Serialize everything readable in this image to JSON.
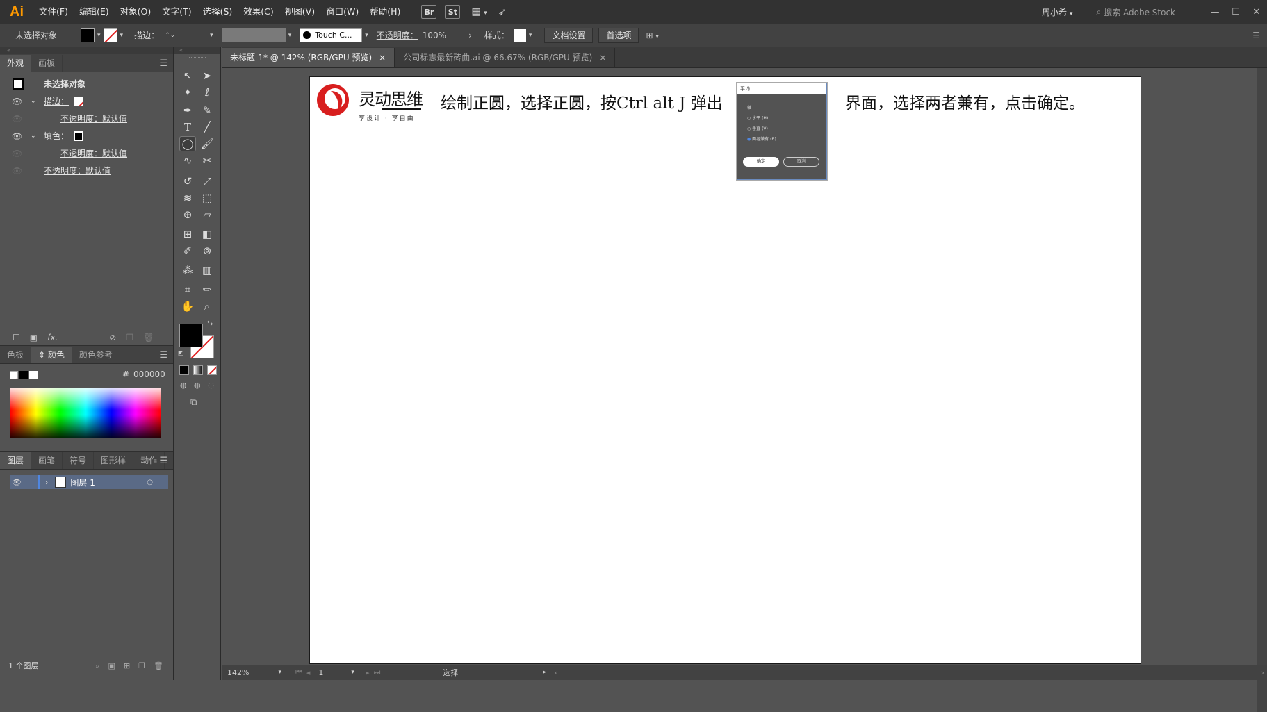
{
  "menubar": {
    "logo": "Ai",
    "menus": [
      "文件(F)",
      "编辑(E)",
      "对象(O)",
      "文字(T)",
      "选择(S)",
      "效果(C)",
      "视图(V)",
      "窗口(W)",
      "帮助(H)"
    ],
    "bridge": "Br",
    "stock": "St",
    "user": "周小希",
    "search_placeholder": "搜索 Adobe Stock",
    "win_minimize": "—",
    "win_maximize": "☐",
    "win_close": "✕"
  },
  "control_bar": {
    "selection": "未选择对象",
    "stroke_label": "描边：",
    "brush": "Touch C...",
    "opacity_label": "不透明度：",
    "opacity_value": "100%",
    "style_label": "样式：",
    "doc_setup": "文档设置",
    "preferences": "首选项"
  },
  "appearance_panel": {
    "tabs": [
      "外观",
      "画板"
    ],
    "title": "未选择对象",
    "stroke_label": "描边：",
    "stroke_opacity": "不透明度：默认值",
    "fill_label": "填色：",
    "fill_opacity": "不透明度：默认值",
    "opacity": "不透明度：默认值",
    "fx": "fx."
  },
  "color_panel": {
    "tabs": [
      "色板",
      "颜色",
      "颜色参考"
    ],
    "hash": "#",
    "hex": "000000"
  },
  "layers_panel": {
    "tabs": [
      "图层",
      "画笔",
      "符号",
      "图形样",
      "动作"
    ],
    "layer_name": "图层 1",
    "count": "1 个图层"
  },
  "document_tabs": [
    {
      "label": "未标题-1* @ 142% (RGB/GPU 预览)",
      "close": "×"
    },
    {
      "label": "公司标志最新砖曲.ai @ 66.67% (RGB/GPU 预览)",
      "close": "×"
    }
  ],
  "artboard": {
    "logo_text": "灵动思维",
    "logo_sub": "享设计 · 享自由",
    "instruction_1": "绘制正圆，选择正圆，按Ctrl alt  J 弹出",
    "instruction_2": "界面，选择两者兼有，点击确定。"
  },
  "dialog": {
    "title": "平均",
    "axis_label": "轴",
    "options": [
      "水平 (H)",
      "垂直 (V)",
      "两者兼有 (B)"
    ],
    "selected_option": "两者兼有 (B)",
    "ok": "确定",
    "cancel": "取消"
  },
  "status_bar": {
    "zoom": "142%",
    "page": "1",
    "tool": "选择"
  },
  "colors": {
    "accent_orange": "#ff9a00",
    "panel_bg": "#535353",
    "bar_bg": "#424242",
    "logo_red": "#d81e1e"
  }
}
